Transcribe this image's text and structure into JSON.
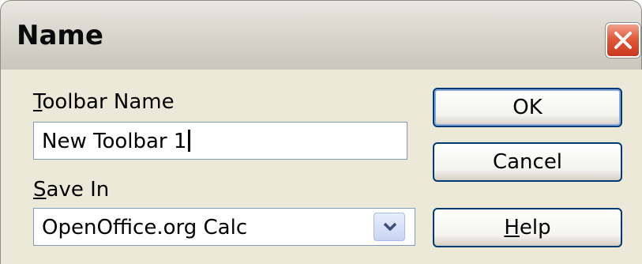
{
  "dialog": {
    "title": "Name",
    "toolbar_name_label_accel": "T",
    "toolbar_name_label_rest": "oolbar Name",
    "toolbar_name_value": "New Toolbar 1",
    "save_in_label_accel": "S",
    "save_in_label_rest": "ave In",
    "save_in_value": "OpenOffice.org Calc",
    "ok_label": "OK",
    "cancel_label": "Cancel",
    "help_label_accel": "H",
    "help_label_rest": "elp"
  },
  "icons": {
    "close": "close-icon",
    "dropdown": "chevron-down-icon"
  },
  "colors": {
    "close_button": "#e05a3c",
    "dialog_background": "#ece9d8",
    "button_border": "#003c74",
    "input_border": "#7f9db9"
  }
}
